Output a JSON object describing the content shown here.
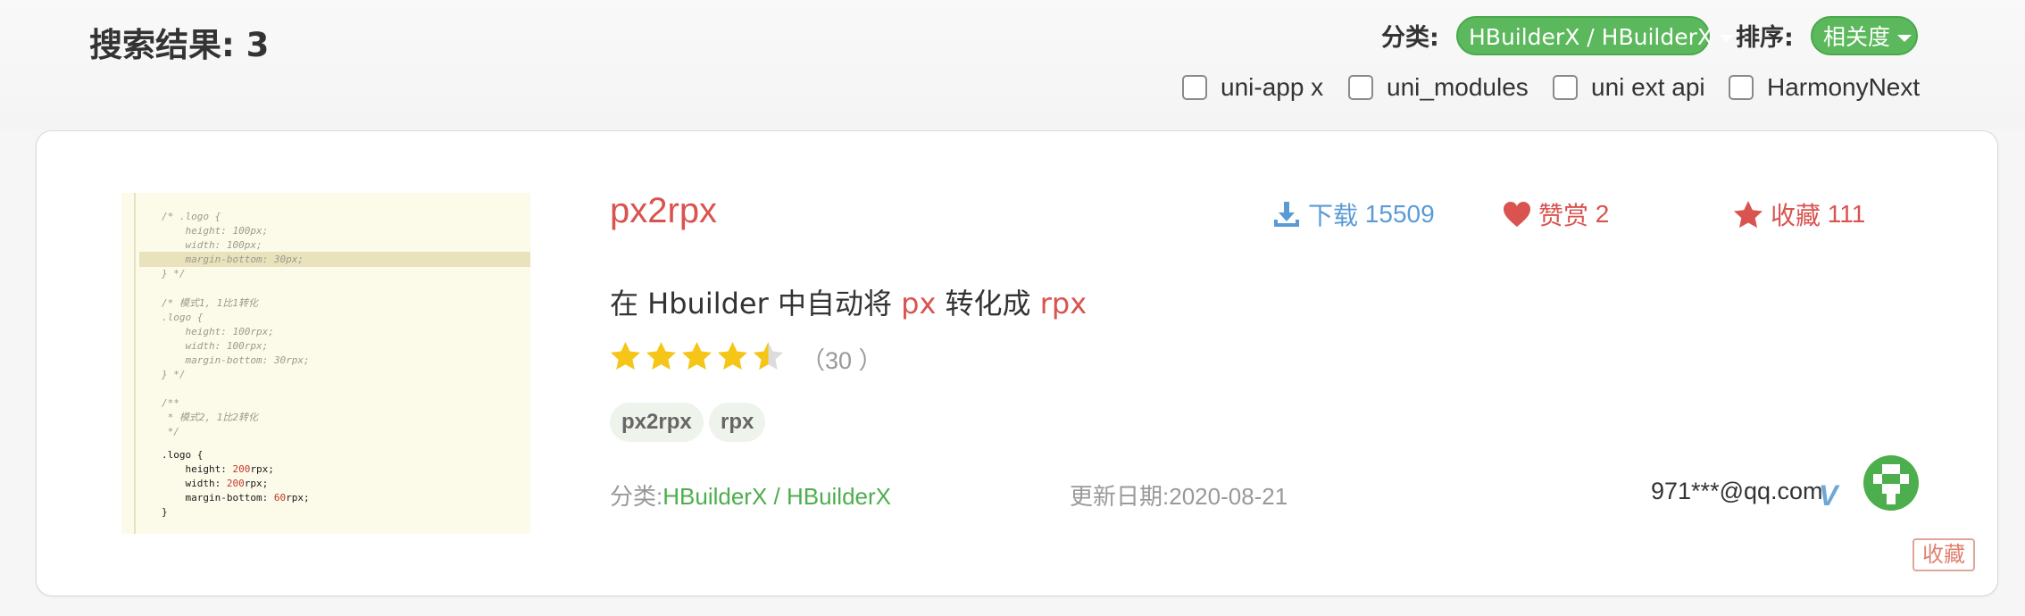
{
  "header": {
    "result_title": "搜索结果: 3",
    "category_label": "分类:",
    "category_value": "HBuilderX / HBuilderX",
    "sort_label": "排序:",
    "sort_value": "相关度",
    "checkboxes": [
      {
        "label": "uni-app x",
        "checked": false
      },
      {
        "label": "uni_modules",
        "checked": false
      },
      {
        "label": "uni ext api",
        "checked": false
      },
      {
        "label": "HarmonyNext",
        "checked": false
      }
    ]
  },
  "plugin": {
    "name": "px2rpx",
    "stats": {
      "download_label": "下载",
      "download_count": "15509",
      "reward_label": "赞赏",
      "reward_count": "2",
      "favorite_label": "收藏",
      "favorite_count": "111"
    },
    "description": {
      "part1": "在 Hbuilder 中自动将 ",
      "keyword1": "px",
      "part2": " 转化成 ",
      "keyword2": "rpx"
    },
    "rating": {
      "stars": 4.5,
      "max": 5,
      "count_text": "（30 ）"
    },
    "tags": [
      "px2rpx",
      "rpx"
    ],
    "category_label": "分类:",
    "category_value": "HBuilderX / HBuilderX",
    "updated_label": "更新日期:",
    "updated_value": "2020-08-21",
    "author": "971***@qq.com",
    "verified_icon": "V",
    "favorite_button": "收藏",
    "thumbnail_code": {
      "lines_commented": "/* .logo {\n    height: 100px;\n    width: 100px;\n    margin-bottom: 30px;\n} */\n\n/* 模式1, 1比1转化\n.logo {\n    height: 100rpx;\n    width: 100rpx;\n    margin-bottom: 30rpx;\n} */\n\n/**\n * 模式2, 1比2转化\n */",
      "selector": ".logo {",
      "prop1": "    height: ",
      "val1": "200",
      "unit1": "rpx;",
      "prop2": "    width: ",
      "val2": "200",
      "unit2": "rpx;",
      "prop3": "    margin-bottom: ",
      "val3": "60",
      "unit3": "rpx;",
      "close": "}"
    }
  },
  "colors": {
    "accent_green": "#5cb85c",
    "title_red": "#d9534f",
    "download_blue": "#5b9bd5",
    "star_yellow": "#f5c518"
  }
}
